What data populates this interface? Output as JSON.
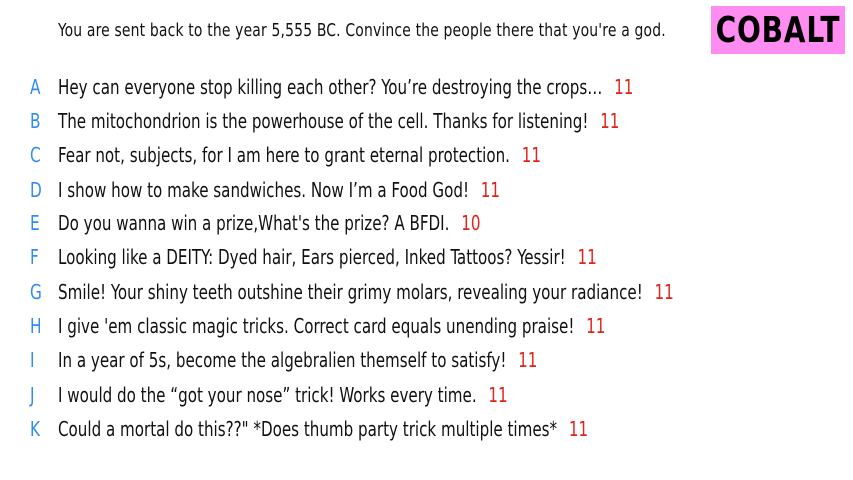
{
  "prompt": "You are sent back to the year 5,555 BC. Convince the people there that you're a god.",
  "team": "COBALT",
  "colors": {
    "letter": "#2f8cf0",
    "score": "#e0241b",
    "badge": "#ff8cf0"
  },
  "answers": [
    {
      "letter": "A",
      "text": "Hey can everyone stop killing each other? You’re destroying the crops…",
      "score": "11"
    },
    {
      "letter": "B",
      "text": "The mitochondrion is the powerhouse of the cell. Thanks for listening!",
      "score": "11"
    },
    {
      "letter": "C",
      "text": "Fear not, subjects, for I am here to grant eternal protection.",
      "score": "11"
    },
    {
      "letter": "D",
      "text": "I show how to make sandwiches. Now I’m a Food God!",
      "score": "11"
    },
    {
      "letter": "E",
      "text": "Do you wanna win a prize,What's the prize? A BFDI.",
      "score": "10"
    },
    {
      "letter": "F",
      "text": "Looking like a DEITY: Dyed hair, Ears pierced, Inked Tattoos? Yessir!",
      "score": "11"
    },
    {
      "letter": "G",
      "text": "Smile! Your shiny teeth outshine their grimy molars, revealing your radiance!",
      "score": "11"
    },
    {
      "letter": "H",
      "text": "I give 'em classic magic tricks. Correct card equals unending praise!",
      "score": "11"
    },
    {
      "letter": "I",
      "text": "In a year of 5s, become the algebralien themself to satisfy!",
      "score": "11"
    },
    {
      "letter": "J",
      "text": "I would do the “got your nose” trick! Works every time.",
      "score": "11"
    },
    {
      "letter": "K",
      "text": "Could a mortal do this??\" *Does thumb party trick multiple times*",
      "score": "11"
    }
  ]
}
